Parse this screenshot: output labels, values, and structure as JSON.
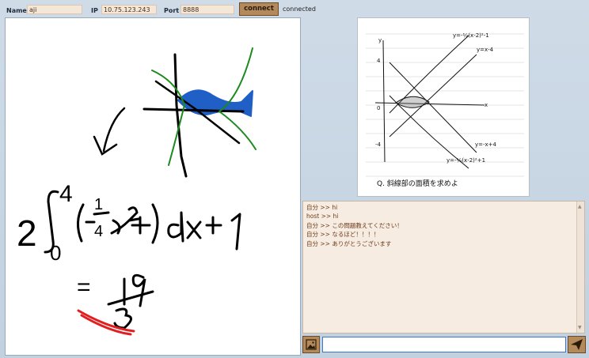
{
  "connection": {
    "name_label": "Name",
    "name_value": "aji",
    "ip_label": "IP",
    "ip_value": "10.75.123.243",
    "port_label": "Port",
    "port_value": "8888",
    "connect_label": "connect",
    "status_text": "connected"
  },
  "drawing": {
    "expr_scale": "2",
    "integral_upper": "4",
    "integral_lower": "0",
    "result_prefix": "="
  },
  "photo": {
    "eq1": "y=-¼(x-2)²-1",
    "eq2": "y=x-4",
    "eq3": "y=-x+4",
    "eq4": "y=-¼(x-2)²+1",
    "axis_x": "x",
    "axis_y": "y",
    "tick4": "4",
    "tickm4": "-4",
    "origin": "0",
    "question": "Q. 斜線部の面積を求めよ"
  },
  "chat": {
    "messages": [
      "自分 >> hi",
      "host >> hi",
      "自分 >> この問題教えてください！",
      "自分 >> なるほど！！！！",
      "自分 >> ありがとうございます"
    ],
    "input_value": ""
  },
  "colors": {
    "accent": "#b48a5a",
    "chat_text": "#6a3a16",
    "fill_blue": "#1f5fc6",
    "curve_green": "#1d8a1d",
    "red_underline": "#e02020"
  }
}
